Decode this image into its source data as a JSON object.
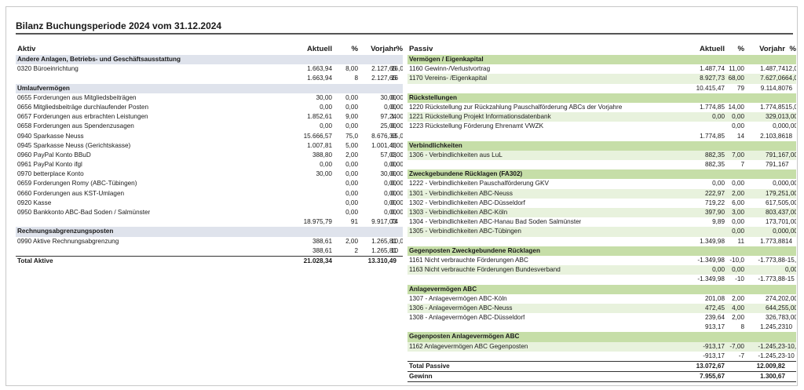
{
  "title": "Bilanz Buchungsperiode 2024 vom 31.12.2024",
  "left": {
    "header": {
      "label": "Aktiv",
      "aktuell": "Aktuell",
      "pct": "%",
      "vorjahr": "Vorjahr",
      "pct2": "%"
    },
    "rows": [
      {
        "type": "sec",
        "label": "Andere Anlagen, Betriebs- und Geschäftsausstattung"
      },
      {
        "type": "item",
        "label": "0320 Büroeinrichtung",
        "a": "1.663,94",
        "p": "8,00",
        "v": "2.127,65",
        "q": "16,0"
      },
      {
        "type": "sub",
        "label": "",
        "a": "1.663,94",
        "p": "8",
        "v": "2.127,65",
        "q": "16"
      },
      {
        "type": "sec",
        "label": "Umlaufvermögen"
      },
      {
        "type": "item",
        "label": "0655 Forderungen aus Mitgliedsbeiträgen",
        "a": "30,00",
        "p": "0,00",
        "v": "30,00",
        "q": "0,00"
      },
      {
        "type": "item",
        "label": "0656 Mitgliedsbeiträge durchlaufender Posten",
        "a": "0,00",
        "p": "0,00",
        "v": "0,00",
        "q": "0,00"
      },
      {
        "type": "item",
        "label": "0657 Forderungen aus erbrachten Leistungen",
        "a": "1.852,61",
        "p": "9,00",
        "v": "97,24",
        "q": "1,00"
      },
      {
        "type": "item",
        "label": "0658 Forderungen aus Spendenzusagen",
        "a": "0,00",
        "p": "0,00",
        "v": "25,00",
        "q": "0,00"
      },
      {
        "type": "item",
        "label": "0940 Sparkasse Neuss",
        "a": "15.666,57",
        "p": "75,0",
        "v": "8.676,33",
        "q": "65,0"
      },
      {
        "type": "item",
        "label": "0945 Sparkasse Neuss (Gerichtskasse)",
        "a": "1.007,81",
        "p": "5,00",
        "v": "1.001,43",
        "q": "8,00"
      },
      {
        "type": "item",
        "label": "0960 PayPal Konto BBuD",
        "a": "388,80",
        "p": "2,00",
        "v": "57,03",
        "q": "0,00"
      },
      {
        "type": "item",
        "label": "0961 PayPal Konto ifgl",
        "a": "0,00",
        "p": "0,00",
        "v": "0,00",
        "q": "0,00"
      },
      {
        "type": "item",
        "label": "0970 betterplace Konto",
        "a": "30,00",
        "p": "0,00",
        "v": "30,00",
        "q": "0,00"
      },
      {
        "type": "item",
        "label": "0659 Forderungen Romy (ABC-Tübingen)",
        "a": "",
        "p": "0,00",
        "v": "0,00",
        "q": "0,00"
      },
      {
        "type": "item",
        "label": "0660 Forderungen aus KST-Umlagen",
        "a": "",
        "p": "0,00",
        "v": "0,00",
        "q": "0,00"
      },
      {
        "type": "item",
        "label": "0920 Kasse",
        "a": "",
        "p": "0,00",
        "v": "0,00",
        "q": "0,00"
      },
      {
        "type": "item",
        "label": "0950 Bankkonto ABC-Bad Soden / Salmünster",
        "a": "",
        "p": "0,00",
        "v": "0,00",
        "q": "0,00"
      },
      {
        "type": "sub",
        "label": "",
        "a": "18.975,79",
        "p": "91",
        "v": "9.917,03",
        "q": "74"
      },
      {
        "type": "sec",
        "label": "Rechnungsabgrenzungsposten"
      },
      {
        "type": "item",
        "label": "0990 Aktive Rechnungsabgrenzung",
        "a": "388,61",
        "p": "2,00",
        "v": "1.265,81",
        "q": "10,0"
      },
      {
        "type": "sub",
        "label": "",
        "a": "388,61",
        "p": "2",
        "v": "1.265,81",
        "q": "10"
      },
      {
        "type": "tot",
        "label": "Total Aktive",
        "a": "21.028,34",
        "p": "",
        "v": "13.310,49",
        "q": ""
      }
    ]
  },
  "right": {
    "header": {
      "label": "Passiv",
      "aktuell": "Aktuell",
      "pct": "%",
      "vorjahr": "Vorjahr",
      "pct2": "%"
    },
    "rows": [
      {
        "type": "sec",
        "label": "Vermögen / Eigenkapital"
      },
      {
        "type": "item",
        "label": "1160 Gewinn-/Verlustvortrag",
        "a": "1.487,74",
        "p": "11,00",
        "v": "1.487,74",
        "q": "12,00"
      },
      {
        "type": "alt",
        "label": "1170 Vereins- /Eigenkapital",
        "a": "8.927,73",
        "p": "68,00",
        "v": "7.627,06",
        "q": "64,00"
      },
      {
        "type": "sub",
        "label": "",
        "a": "10.415,47",
        "p": "79",
        "v": "9.114,80",
        "q": "76"
      },
      {
        "type": "sec",
        "label": "Rückstellungen"
      },
      {
        "type": "item",
        "label": "1220 Rückstellung zur Rückzahlung Pauschalförderung ABCs der Vorjahre",
        "a": "1.774,85",
        "p": "14,00",
        "v": "1.774,85",
        "q": "15,00"
      },
      {
        "type": "alt",
        "label": "1221 Rückstellung Projekt Informationsdatenbank",
        "a": "0,00",
        "p": "0,00",
        "v": "329,01",
        "q": "3,00"
      },
      {
        "type": "item",
        "label": "1223 Rückstellung Förderung Ehrenamt VWZK",
        "a": "",
        "p": "0,00",
        "v": "0,00",
        "q": "0,00"
      },
      {
        "type": "sub",
        "label": "",
        "a": "1.774,85",
        "p": "14",
        "v": "2.103,86",
        "q": "18"
      },
      {
        "type": "sec",
        "label": "Verbindlichkeiten"
      },
      {
        "type": "alt",
        "label": "1306 - Verbindlichkeiten aus LuL",
        "a": "882,35",
        "p": "7,00",
        "v": "791,16",
        "q": "7,00"
      },
      {
        "type": "sub",
        "label": "",
        "a": "882,35",
        "p": "7",
        "v": "791,16",
        "q": "7"
      },
      {
        "type": "sec",
        "label": "Zweckgebundene Rücklagen (FA302)"
      },
      {
        "type": "item",
        "label": "1222 - Verbindlichkeiten Pauschalförderung GKV",
        "a": "0,00",
        "p": "0,00",
        "v": "0,00",
        "q": "0,00"
      },
      {
        "type": "alt",
        "label": "1301 - Verbindlichkeiten ABC-Neuss",
        "a": "222,97",
        "p": "2,00",
        "v": "179,25",
        "q": "1,00"
      },
      {
        "type": "item",
        "label": "1302 - Verbindlichkeiten ABC-Düsseldorf",
        "a": "719,22",
        "p": "6,00",
        "v": "617,50",
        "q": "5,00"
      },
      {
        "type": "alt",
        "label": "1303 - Verbindlichkeiten ABC-Köln",
        "a": "397,90",
        "p": "3,00",
        "v": "803,43",
        "q": "7,00"
      },
      {
        "type": "item",
        "label": "1304 - Verbindlichkeiten ABC-Hanau Bad Soden Salmünster",
        "a": "9,89",
        "p": "0,00",
        "v": "173,70",
        "q": "1,00"
      },
      {
        "type": "alt",
        "label": "1305 - Verbindlichkeiten ABC-Tübingen",
        "a": "",
        "p": "0,00",
        "v": "0,00",
        "q": "0,00"
      },
      {
        "type": "sub",
        "label": "",
        "a": "1.349,98",
        "p": "11",
        "v": "1.773,88",
        "q": "14"
      },
      {
        "type": "sec",
        "label": "Gegenposten Zweckgebundene Rücklagen"
      },
      {
        "type": "item",
        "label": "1161 Nicht verbrauchte Förderungen ABC",
        "a": "-1.349,98",
        "p": "-10,0",
        "v": "-1.773,88",
        "q": "-15,0"
      },
      {
        "type": "alt",
        "label": "1163 Nicht verbrauchte Förderungen Bundesverband",
        "a": "0,00",
        "p": "0,00",
        "v": "",
        "q": "0,00"
      },
      {
        "type": "sub",
        "label": "",
        "a": "-1.349,98",
        "p": "-10",
        "v": "-1.773,88",
        "q": "-15"
      },
      {
        "type": "sec",
        "label": "Anlagevermögen ABC"
      },
      {
        "type": "item",
        "label": "1307 - Anlagevermögen ABC-Köln",
        "a": "201,08",
        "p": "2,00",
        "v": "274,20",
        "q": "2,00"
      },
      {
        "type": "alt",
        "label": "1306 - Anlagevermögen ABC-Neuss",
        "a": "472,45",
        "p": "4,00",
        "v": "644,25",
        "q": "5,00"
      },
      {
        "type": "item",
        "label": "1308 - Anlagevermögen ABC-Düsseldorf",
        "a": "239,64",
        "p": "2,00",
        "v": "326,78",
        "q": "3,00"
      },
      {
        "type": "sub",
        "label": "",
        "a": "913,17",
        "p": "8",
        "v": "1.245,23",
        "q": "10"
      },
      {
        "type": "sec",
        "label": "Gegenposten Anlagevermögen ABC"
      },
      {
        "type": "alt",
        "label": "1162 Anlagevermögen ABC Gegenposten",
        "a": "-913,17",
        "p": "-7,00",
        "v": "-1.245,23",
        "q": "-10,0"
      },
      {
        "type": "sub",
        "label": "",
        "a": "-913,17",
        "p": "-7",
        "v": "-1.245,23",
        "q": "-10"
      },
      {
        "type": "tot",
        "label": "Total Passive",
        "a": "13.072,67",
        "p": "",
        "v": "12.009,82",
        "q": ""
      },
      {
        "type": "tot2",
        "label": "Gewinn",
        "a": "7.955,67",
        "p": "",
        "v": "1.300,67",
        "q": ""
      }
    ]
  }
}
